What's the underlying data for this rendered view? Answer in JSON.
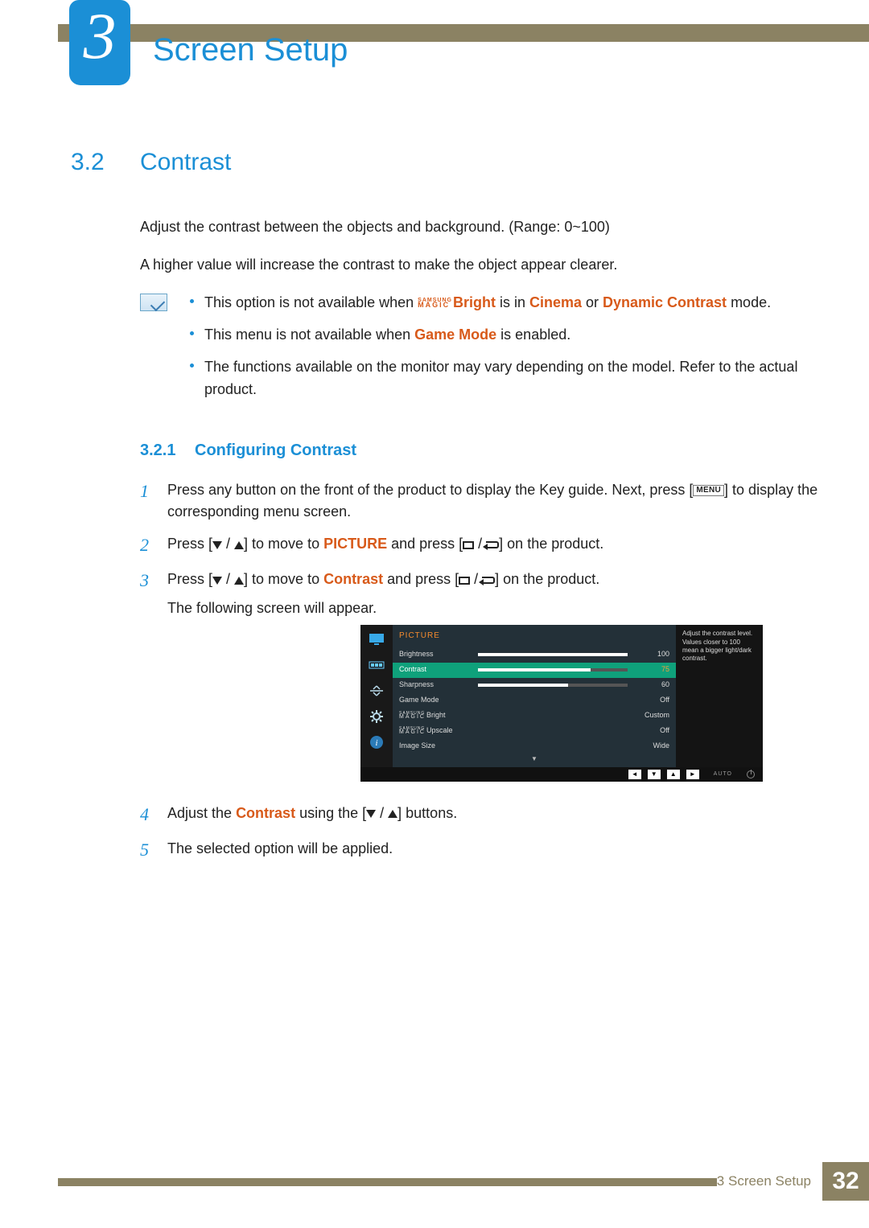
{
  "chapter": {
    "number": "3",
    "title": "Screen Setup"
  },
  "section": {
    "number": "3.2",
    "title": "Contrast"
  },
  "intro": {
    "p1": "Adjust the contrast between the objects and background. (Range: 0~100)",
    "p2": "A higher value will increase the contrast to make the object appear clearer."
  },
  "notes": {
    "n1_a": "This option is not available when ",
    "n1_magic_top": "SAMSUNG",
    "n1_magic_bot": "MAGIC",
    "n1_bright": "Bright",
    "n1_b": " is in ",
    "n1_cinema": "Cinema",
    "n1_or": " or ",
    "n1_dyn": "Dynamic Contrast",
    "n1_c": " mode.",
    "n2_a": "This menu is not available when ",
    "n2_game": "Game Mode",
    "n2_b": " is enabled.",
    "n3": "The functions available on the monitor may vary depending on the model. Refer to the actual product."
  },
  "subsection": {
    "number": "3.2.1",
    "title": "Configuring Contrast"
  },
  "steps": {
    "s1_a": "Press any button on the front of the product to display the Key guide. Next, press [",
    "s1_menu": "MENU",
    "s1_b": "] to display the corresponding menu screen.",
    "s2_a": "Press [",
    "s2_b": "] to move to ",
    "s2_pic": "PICTURE",
    "s2_c": " and press [",
    "s2_d": "] on the product.",
    "s3_a": "Press [",
    "s3_b": "] to move to ",
    "s3_con": "Contrast",
    "s3_c": " and press [",
    "s3_d": "] on the product.",
    "s3_e": "The following screen will appear.",
    "s4_a": "Adjust the ",
    "s4_con": "Contrast",
    "s4_b": " using the [",
    "s4_c": "] buttons.",
    "s5": "The selected option will be applied."
  },
  "stepnums": {
    "n1": "1",
    "n2": "2",
    "n3": "3",
    "n4": "4",
    "n5": "5"
  },
  "osd": {
    "head": "PICTURE",
    "tip": "Adjust the contrast level. Values closer to 100 mean a bigger light/dark contrast.",
    "magic_s": "SAMSUNG",
    "magic_m": "MAGIC",
    "rows": {
      "brightness": {
        "label": "Brightness",
        "value": "100"
      },
      "contrast": {
        "label": "Contrast",
        "value": "75"
      },
      "sharpness": {
        "label": "Sharpness",
        "value": "60"
      },
      "gamemode": {
        "label": "Game Mode",
        "value": "Off"
      },
      "magicbright": {
        "label": "Bright",
        "value": "Custom"
      },
      "magicupscale": {
        "label": "Upscale",
        "value": "Off"
      },
      "imagesize": {
        "label": "Image Size",
        "value": "Wide"
      }
    },
    "foot_auto": "AUTO"
  },
  "footer": {
    "label": "3 Screen Setup",
    "page": "32"
  }
}
